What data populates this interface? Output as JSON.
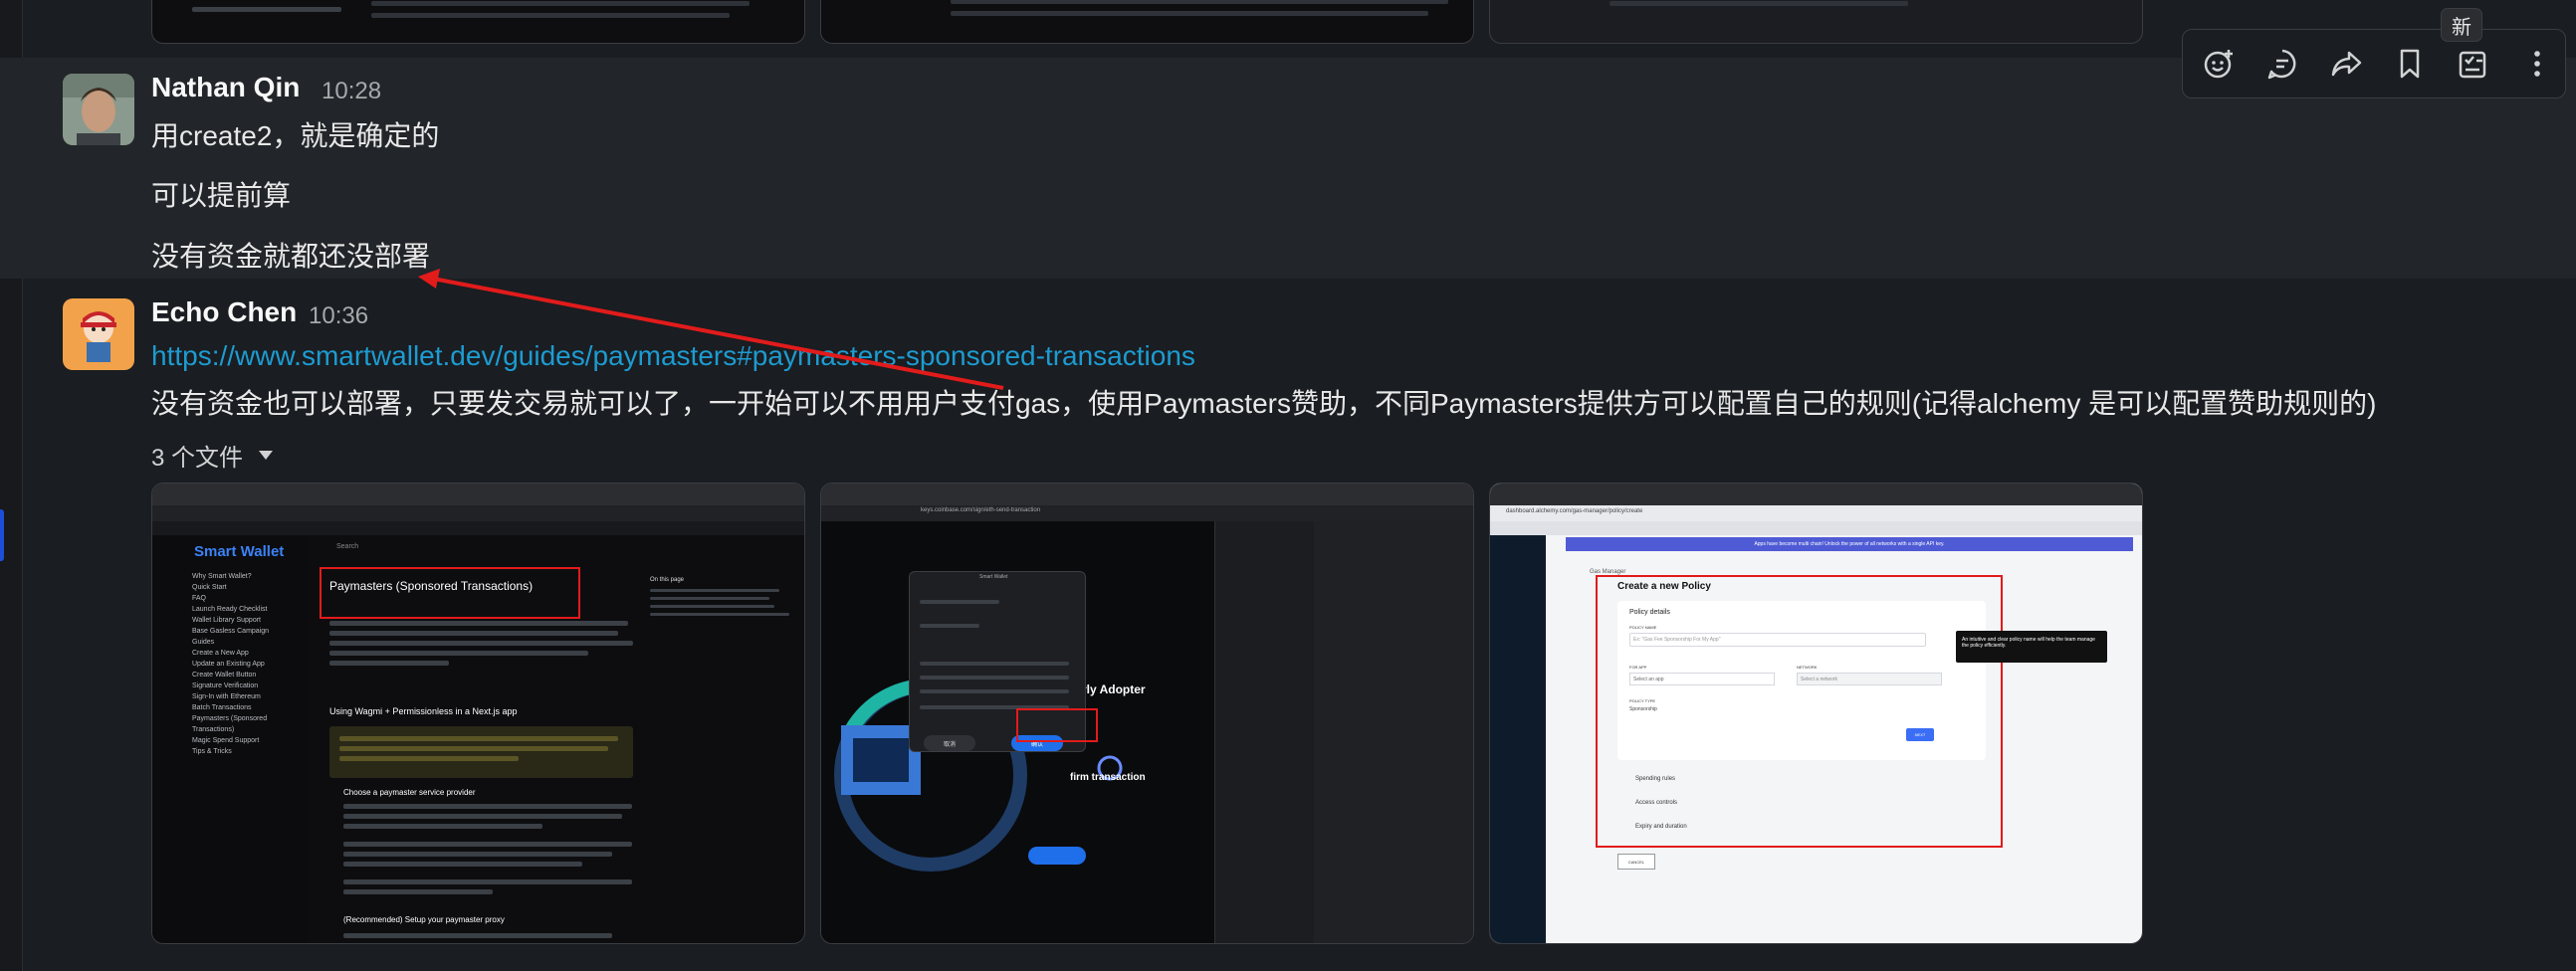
{
  "badge_new": "新",
  "toolbar": {
    "add_reaction": "add-reaction-icon",
    "reply": "reply-in-thread-icon",
    "forward": "forward-icon",
    "bookmark": "bookmark-icon",
    "add_task": "add-task-icon",
    "more": "more-vertical-icon"
  },
  "messages": [
    {
      "author": "Nathan Qin",
      "time": "10:28",
      "lines": [
        "用create2，就是确定的",
        "可以提前算",
        "没有资金就都还没部署"
      ]
    },
    {
      "author": "Echo Chen",
      "time": "10:36",
      "link": "https://www.smartwallet.dev/guides/paymasters#paymasters-sponsored-transactions",
      "text": "没有资金也可以部署，只要发交易就可以了，一开始可以不用用户支付gas，使用Paymasters赞助，不同Paymasters提供方可以配置自己的规则(记得alchemy 是可以配置赞助规则的)",
      "files_label": "3 个文件"
    }
  ],
  "attachments": {
    "shot1": {
      "brand": "Smart Wallet",
      "search": "Search",
      "heading": "Paymasters (Sponsored Transactions)",
      "section": "Using Wagmi + Permissionless in a Next.js app",
      "step1": "Choose a paymaster service provider",
      "step2": "(Recommended) Setup your paymaster proxy",
      "on_this_page": "On this page",
      "nav": [
        "Why Smart Wallet?",
        "Quick Start",
        "FAQ",
        "Launch Ready Checklist",
        "Wallet Library Support",
        "Base Gasless Campaign",
        "Guides",
        "Create a New App",
        "Update an Existing App",
        "Create Wallet Button",
        "Signature Verification",
        "Sign-In with Ethereum",
        "Batch Transactions",
        "Paymasters (Sponsored Transactions)",
        "Magic Spend Support",
        "Tips & Tricks"
      ]
    },
    "shot2": {
      "url": "keys.coinbase.com/sign/eth-send-transaction",
      "promo": "let Early Adopter",
      "confirm": "firm transaction",
      "dialog_title": "Smart Wallet",
      "cancel": "取消",
      "confirm_btn": "确认"
    },
    "shot3": {
      "url": "dashboard.alchemy.com/gas-manager/policy/create",
      "banner": "Apps have become multi chain! Unlock the power of all networks with a single API key.",
      "breadcrumb": "Gas Manager",
      "title": "Create a new Policy",
      "policy_details": "Policy details",
      "policy_name": "POLICY NAME",
      "policy_name_placeholder": "Ex: \"Gas Fee Sponsorship For My App\"",
      "for_app": "FOR APP",
      "select_app": "Select an app",
      "network": "NETWORK",
      "select_network": "Select a network",
      "policy_type": "POLICY TYPE",
      "policy_type_value": "Sponsorship",
      "next": "NEXT",
      "spending_rules": "Spending rules",
      "access_controls": "Access controls",
      "expiry": "Expiry and duration",
      "cancel": "CANCEL",
      "tooltip": "An intuitive and clear policy name will help the team manage the policy efficiently."
    }
  }
}
